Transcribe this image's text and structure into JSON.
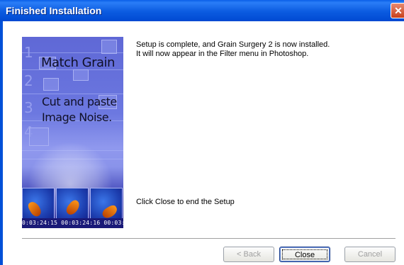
{
  "window": {
    "title": "Finished Installation",
    "close_glyph": "✕"
  },
  "art": {
    "numbers": [
      "1",
      "2",
      "3",
      "4"
    ],
    "heading": "Match Grain",
    "line1": "Cut and paste",
    "line2": "Image Noise.",
    "timecodes": "0:03:24:15  00:03:24:16  00:03:2"
  },
  "message": {
    "line1": "Setup is complete, and Grain Surgery 2 is now installed.",
    "line2": "It will now appear in the Filter menu in Photoshop.",
    "end_text": "Click Close to end the Setup"
  },
  "buttons": {
    "back": "< Back",
    "close": "Close",
    "cancel": "Cancel"
  },
  "colors": {
    "titlebar": "#0054e3",
    "close_button": "#d8532a"
  }
}
